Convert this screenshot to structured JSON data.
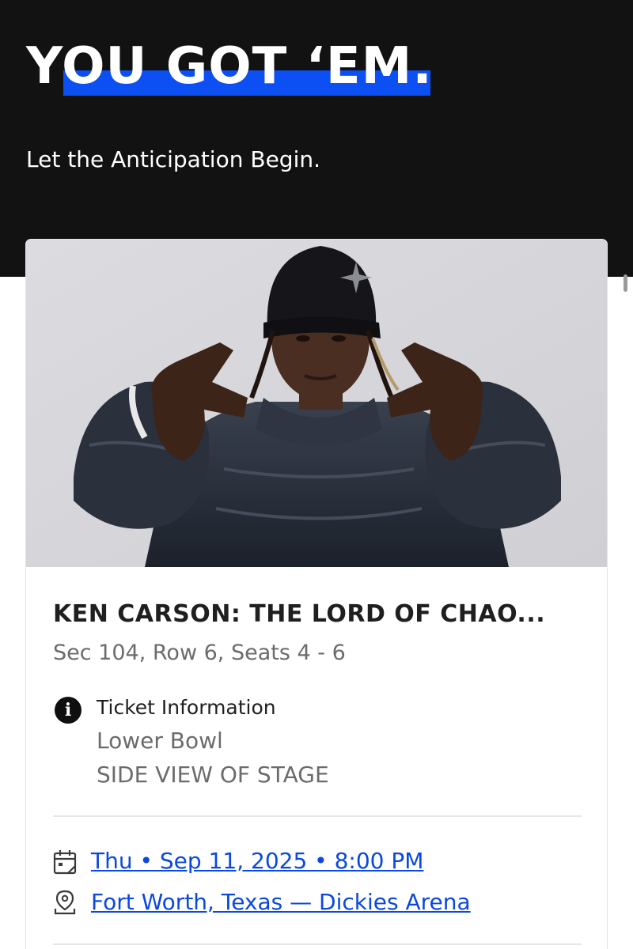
{
  "header": {
    "headline": "YOU GOT ‘EM.",
    "subtitle": "Let the Anticipation Begin."
  },
  "colors": {
    "hero_bg": "#121212",
    "accent_blue": "#0c4ff2",
    "link_blue": "#0a48e0"
  },
  "ticket": {
    "event_title": "KEN CARSON: THE LORD OF CHAO...",
    "seats": "Sec 104, Row 6, Seats 4 - 6",
    "info": {
      "label": "Ticket Information",
      "lines": [
        "Lower Bowl",
        "SIDE VIEW OF STAGE"
      ]
    },
    "datetime": "Thu • Sep 11, 2025 • 8:00 PM",
    "location": "Fort Worth, Texas — Dickies Arena"
  },
  "icons": {
    "info": "info-icon",
    "calendar": "calendar-icon",
    "location": "location-pin-icon"
  }
}
